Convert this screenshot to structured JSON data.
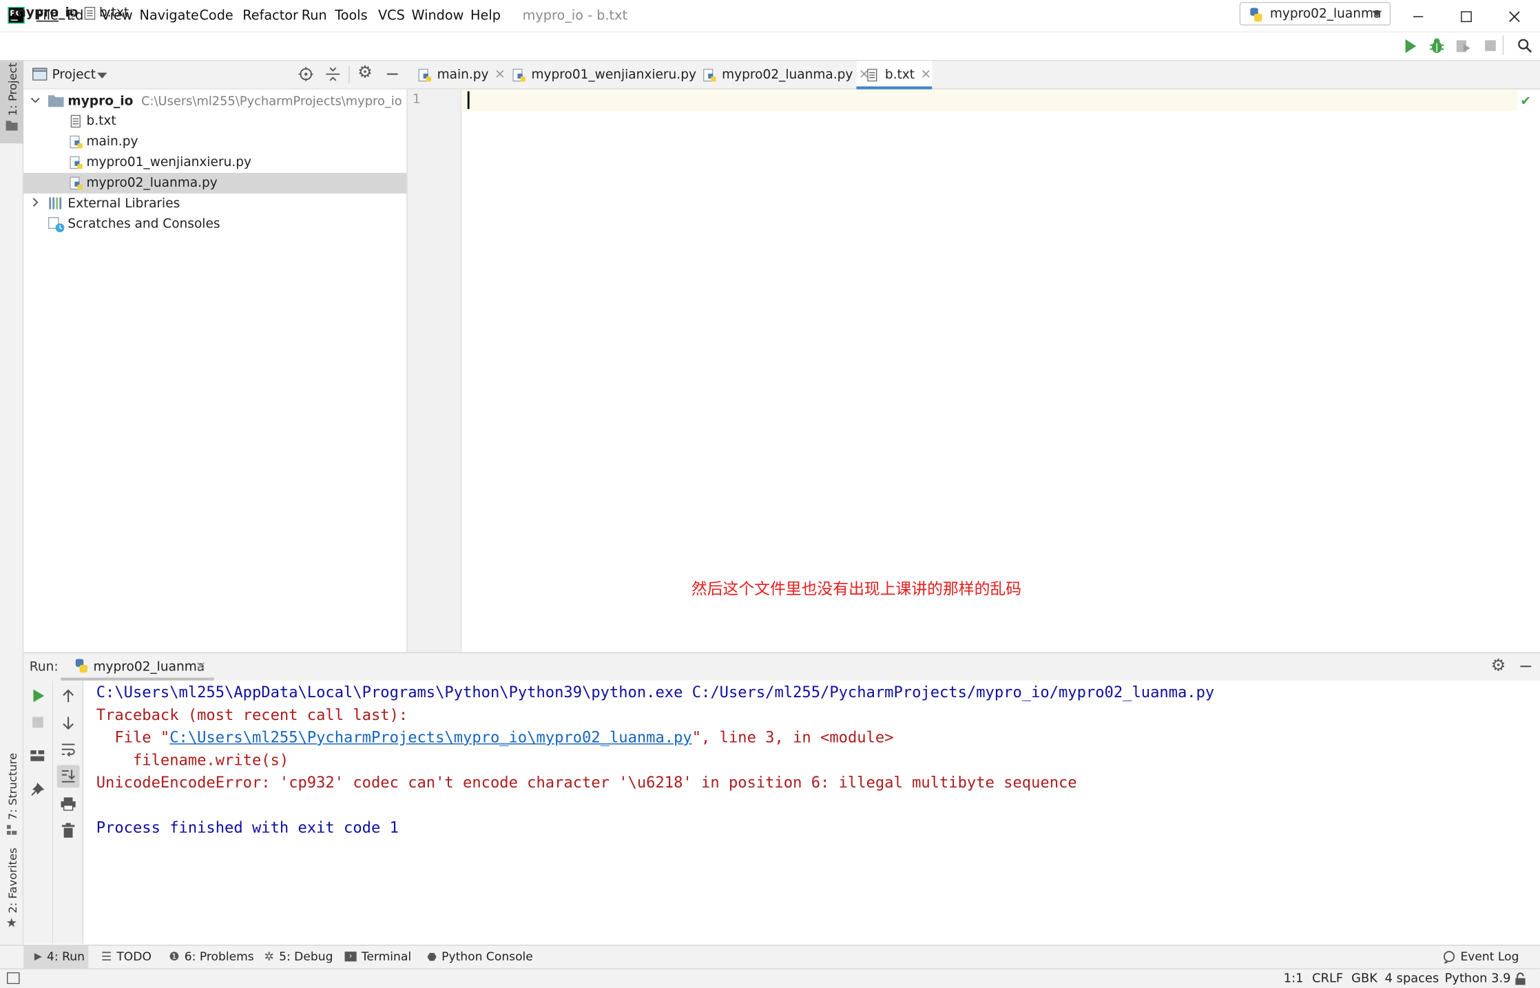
{
  "window": {
    "title": "mypro_io - b.txt",
    "menu": [
      "File",
      "Edit",
      "View",
      "Navigate",
      "Code",
      "Refactor",
      "Run",
      "Tools",
      "VCS",
      "Window",
      "Help"
    ]
  },
  "navbar": {
    "project": "mypro_io",
    "file": "b.txt",
    "run_config": "mypro02_luanma"
  },
  "left_stripe": {
    "project": "1: Project",
    "structure": "7: Structure",
    "favorites": "2: Favorites"
  },
  "project_panel": {
    "title": "Project",
    "root": {
      "name": "mypro_io",
      "path": "C:\\Users\\ml255\\PycharmProjects\\mypro_io"
    },
    "files": [
      "b.txt",
      "main.py",
      "mypro01_wenjianxieru.py",
      "mypro02_luanma.py"
    ],
    "external": "External Libraries",
    "scratches": "Scratches and Consoles"
  },
  "editor": {
    "tabs": [
      "main.py",
      "mypro01_wenjianxieru.py",
      "mypro02_luanma.py",
      "b.txt"
    ],
    "active_tab": "b.txt",
    "line_number": "1",
    "annotation": "然后这个文件里也没有出现上课讲的那样的乱码",
    "annotation_color": "#e51c1c"
  },
  "run_window": {
    "label": "Run:",
    "tab": "mypro02_luanma",
    "console": {
      "line1": "C:\\Users\\ml255\\AppData\\Local\\Programs\\Python\\Python39\\python.exe C:/Users/ml255/PycharmProjects/mypro_io/mypro02_luanma.py",
      "line2": "Traceback (most recent call last):",
      "line3_prefix": "  File \"",
      "line3_link": "C:\\Users\\ml255\\PycharmProjects\\mypro_io\\mypro02_luanma.py",
      "line3_suffix": "\", line 3, in <module>",
      "line4": "    filename.write(s)",
      "line5": "UnicodeEncodeError: 'cp932' codec can't encode character '\\u6218' in position 6: illegal multibyte sequence",
      "line6": "Process finished with exit code 1"
    }
  },
  "bottom_tools": {
    "run": "4: Run",
    "todo": "TODO",
    "problems": "6: Problems",
    "debug": "5: Debug",
    "terminal": "Terminal",
    "python_console": "Python Console",
    "event_log": "Event Log"
  },
  "status": {
    "position": "1:1",
    "line_sep": "CRLF",
    "encoding": "GBK",
    "indent": "4 spaces",
    "interpreter": "Python 3.9"
  }
}
